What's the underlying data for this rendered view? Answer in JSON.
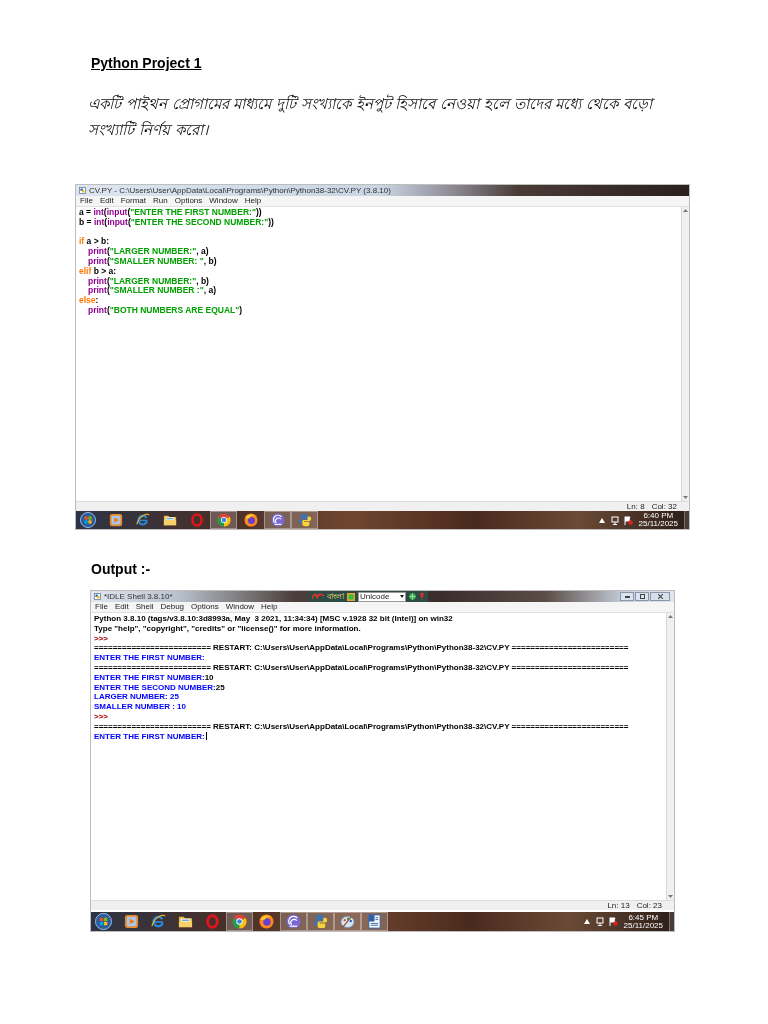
{
  "heading": "Python Project 1",
  "question": "একটি পাইথন প্রোগামের মাধ্যমে দুটি সংখ্যাকে ইনপুট হিসাবে নেওয়া হলে তাদের মধ্যে থেকে বড়ো সংখ্যাটি নির্ণয় করো।",
  "editor_window": {
    "title": "CV.PY - C:\\Users\\User\\AppData\\Local\\Programs\\Python\\Python38-32\\CV.PY (3.8.10)",
    "menu": [
      "File",
      "Edit",
      "Format",
      "Run",
      "Options",
      "Window",
      "Help"
    ],
    "code_blocks": [
      [
        {
          "tokens": [
            {
              "kind": "plain",
              "text": "a = "
            },
            {
              "kind": "builtin",
              "text": "int"
            },
            {
              "kind": "plain",
              "text": "("
            },
            {
              "kind": "builtin",
              "text": "input"
            },
            {
              "kind": "plain",
              "text": "("
            },
            {
              "kind": "string",
              "text": "\"ENTER THE FIRST NUMBER:\""
            },
            {
              "kind": "plain",
              "text": "))"
            }
          ]
        },
        {
          "tokens": [
            {
              "kind": "plain",
              "text": "b = "
            },
            {
              "kind": "builtin",
              "text": "int"
            },
            {
              "kind": "plain",
              "text": "("
            },
            {
              "kind": "builtin",
              "text": "input"
            },
            {
              "kind": "plain",
              "text": "("
            },
            {
              "kind": "string",
              "text": "\"ENTER THE SECOND NUMBER:\""
            },
            {
              "kind": "plain",
              "text": "))"
            }
          ]
        }
      ],
      [
        {
          "tokens": [
            {
              "kind": "keyword",
              "text": "if"
            },
            {
              "kind": "plain",
              "text": " a > b:"
            }
          ],
          "children": [
            {
              "tokens": [
                {
                  "kind": "builtin",
                  "text": "print"
                },
                {
                  "kind": "plain",
                  "text": "("
                },
                {
                  "kind": "string",
                  "text": "\"LARGER NUMBER:\""
                },
                {
                  "kind": "plain",
                  "text": ", a)"
                }
              ]
            },
            {
              "tokens": [
                {
                  "kind": "builtin",
                  "text": "print"
                },
                {
                  "kind": "plain",
                  "text": "("
                },
                {
                  "kind": "string",
                  "text": "\"SMALLER NUMBER: \""
                },
                {
                  "kind": "plain",
                  "text": ", b)"
                }
              ]
            }
          ]
        },
        {
          "tokens": [
            {
              "kind": "keyword",
              "text": "elif"
            },
            {
              "kind": "plain",
              "text": " b > a:"
            }
          ],
          "children": [
            {
              "tokens": [
                {
                  "kind": "builtin",
                  "text": "print"
                },
                {
                  "kind": "plain",
                  "text": "("
                },
                {
                  "kind": "string",
                  "text": "\"LARGER NUMBER:\""
                },
                {
                  "kind": "plain",
                  "text": ", b)"
                }
              ]
            },
            {
              "tokens": [
                {
                  "kind": "builtin",
                  "text": "print"
                },
                {
                  "kind": "plain",
                  "text": "("
                },
                {
                  "kind": "string",
                  "text": "\"SMALLER NUMBER :\""
                },
                {
                  "kind": "plain",
                  "text": ", a)"
                }
              ]
            }
          ]
        },
        {
          "tokens": [
            {
              "kind": "keyword",
              "text": "else"
            },
            {
              "kind": "plain",
              "text": ":"
            }
          ],
          "children": [
            {
              "tokens": [
                {
                  "kind": "builtin",
                  "text": "print"
                },
                {
                  "kind": "plain",
                  "text": "("
                },
                {
                  "kind": "string",
                  "text": "\"BOTH NUMBERS ARE EQUAL\""
                },
                {
                  "kind": "plain",
                  "text": ")"
                }
              ]
            }
          ]
        }
      ]
    ],
    "status": {
      "line": "Ln: 8",
      "column": "Col: 32"
    },
    "taskbar": {
      "apps": [
        {
          "kind": "media",
          "running": false
        },
        {
          "kind": "ie",
          "running": false
        },
        {
          "kind": "folder",
          "running": false
        },
        {
          "kind": "opera",
          "running": false
        },
        {
          "kind": "chrome",
          "running": true
        },
        {
          "kind": "firefox",
          "running": false
        },
        {
          "kind": "disc",
          "running": true
        },
        {
          "kind": "python",
          "running": true
        }
      ],
      "clock": {
        "time": "6:40 PM",
        "date": "25/11/2025"
      }
    }
  },
  "output_label": "Output :-",
  "shell_window": {
    "title": "*IDLE Shell 3.8.10*",
    "ime_toolbar": {
      "mode": "বাংলা",
      "encoding": "Unicode"
    },
    "menu": [
      "File",
      "Edit",
      "Shell",
      "Debug",
      "Options",
      "Window",
      "Help"
    ],
    "lines": [
      [
        {
          "kind": "output",
          "text": "Python 3.8.10 (tags/v3.8.10:3d8993a, May  3 2021, 11:34:34) [MSC v.1928 32 bit (Intel)] on win32"
        }
      ],
      [
        {
          "kind": "output",
          "text": "Type \"help\", \"copyright\", \"credits\" or \"license()\" for more information."
        }
      ],
      [
        {
          "kind": "prompt",
          "text": ">>>"
        }
      ],
      [
        {
          "kind": "output",
          "text": "========================= RESTART: C:\\Users\\User\\AppData\\Local\\Programs\\Python\\Python38-32\\CV.PY ========================="
        }
      ],
      [
        {
          "kind": "stdout",
          "text": "ENTER THE FIRST NUMBER:"
        }
      ],
      [
        {
          "kind": "output",
          "text": "========================= RESTART: C:\\Users\\User\\AppData\\Local\\Programs\\Python\\Python38-32\\CV.PY ========================="
        }
      ],
      [
        {
          "kind": "stdout",
          "text": "ENTER THE FIRST NUMBER:"
        },
        {
          "kind": "input",
          "text": "10"
        }
      ],
      [
        {
          "kind": "stdout",
          "text": "ENTER THE SECOND NUMBER:"
        },
        {
          "kind": "input",
          "text": "25"
        }
      ],
      [
        {
          "kind": "stdout",
          "text": "LARGER NUMBER: 25"
        }
      ],
      [
        {
          "kind": "stdout",
          "text": "SMALLER NUMBER : 10"
        }
      ],
      [
        {
          "kind": "prompt",
          "text": ">>>"
        }
      ],
      [
        {
          "kind": "output",
          "text": "========================= RESTART: C:\\Users\\User\\AppData\\Local\\Programs\\Python\\Python38-32\\CV.PY ========================="
        }
      ],
      [
        {
          "kind": "stdout",
          "text": "ENTER THE FIRST NUMBER:"
        }
      ]
    ],
    "cursor": true,
    "status": {
      "line": "Ln: 13",
      "column": "Col: 23"
    },
    "taskbar": {
      "apps": [
        {
          "kind": "media",
          "running": false
        },
        {
          "kind": "ie",
          "running": false
        },
        {
          "kind": "folder",
          "running": false
        },
        {
          "kind": "opera",
          "running": false
        },
        {
          "kind": "chrome",
          "running": true
        },
        {
          "kind": "firefox",
          "running": false
        },
        {
          "kind": "disc",
          "running": true
        },
        {
          "kind": "python",
          "running": true
        },
        {
          "kind": "paint",
          "running": true
        },
        {
          "kind": "doc",
          "running": true
        }
      ],
      "clock": {
        "time": "6:45 PM",
        "date": "25/11/2025"
      }
    }
  }
}
